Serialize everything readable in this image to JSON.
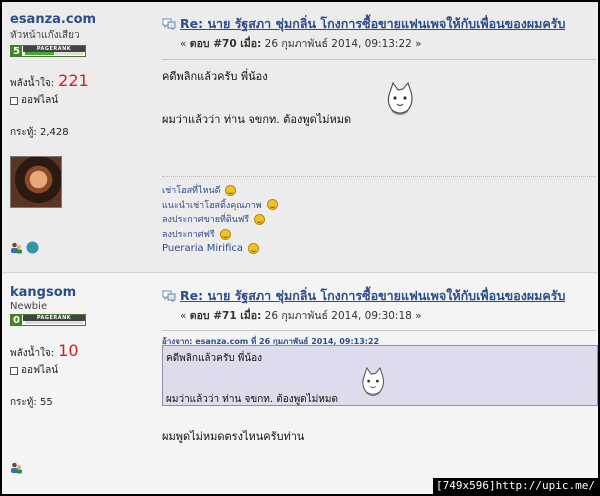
{
  "posts": [
    {
      "poster": {
        "name": "esanza.com",
        "title": "หัวหน้าแก๊งเสียว",
        "pagerank_value": "5",
        "pagerank_label": "PAGERANK",
        "pagerank_level": 0.5,
        "power_label": "พลังน้ำใจ:",
        "power_value": "221",
        "status": "ออฟไลน์",
        "posts_label": "กระทู้:",
        "posts_value": "2,428",
        "has_avatar": true
      },
      "subject": "Re: นาย รัฐสภา ชุ่มกลิ่น โกงการซื้อขายแฟนเพจให้กับเพื่อนของผมครับ",
      "meta": {
        "prefix": "« ",
        "reply_label": "ตอบ #70",
        "when_label": " เมื่อ:",
        "date": " 26 กุมภาพันธ์ 2014, 09:13:22 »"
      },
      "body": {
        "line1": "คดีพลิกแล้วครับ พี่น้อง",
        "line2": "ผมว่าแล้วว่า ท่าน จขกท. ต้องพูดไม่หมด"
      },
      "signature": [
        "เช่าโฮสที่ไหนดี",
        "แนะนำเช่าโฮสติ้งคุณภาพ",
        "ลงประกาศขายที่ดินฟรี",
        "ลงประกาศฟรี",
        "Pueraria Mirifica"
      ]
    },
    {
      "poster": {
        "name": "kangsom",
        "title": "Newbie",
        "pagerank_value": "0",
        "pagerank_label": "PAGERANK",
        "pagerank_level": 0,
        "power_label": "พลังน้ำใจ:",
        "power_value": "10",
        "status": "ออฟไลน์",
        "posts_label": "กระทู้:",
        "posts_value": "55"
      },
      "subject": "Re: นาย รัฐสภา ชุ่มกลิ่น โกงการซื้อขายแฟนเพจให้กับเพื่อนของผมครับ",
      "meta": {
        "prefix": "« ",
        "reply_label": "ตอบ #71",
        "when_label": " เมื่อ:",
        "date": " 26 กุมภาพันธ์ 2014, 09:30:18 »"
      },
      "quote": {
        "header": "อ้างจาก: esanza.com ที่ 26 กุมภาพันธ์ 2014, 09:13:22",
        "line1": "คดีพลิกแล้วครับ พี่น้อง",
        "line2": "ผมว่าแล้วว่า ท่าน จขกท. ต้องพูดไม่หมด"
      },
      "body": {
        "line1": "ผมพูดไม่หมดตรงไหนครับท่าน"
      }
    }
  ],
  "watermark": "[749x596]http://upic.me/",
  "colors": {
    "link": "#2a4d8f",
    "power": "#d32020",
    "quote_bg": "#dcdcec"
  },
  "icons": [
    "message-icon",
    "user-profile-icon",
    "globe-icon",
    "smiley-icon",
    "cat-emoticon-icon"
  ]
}
